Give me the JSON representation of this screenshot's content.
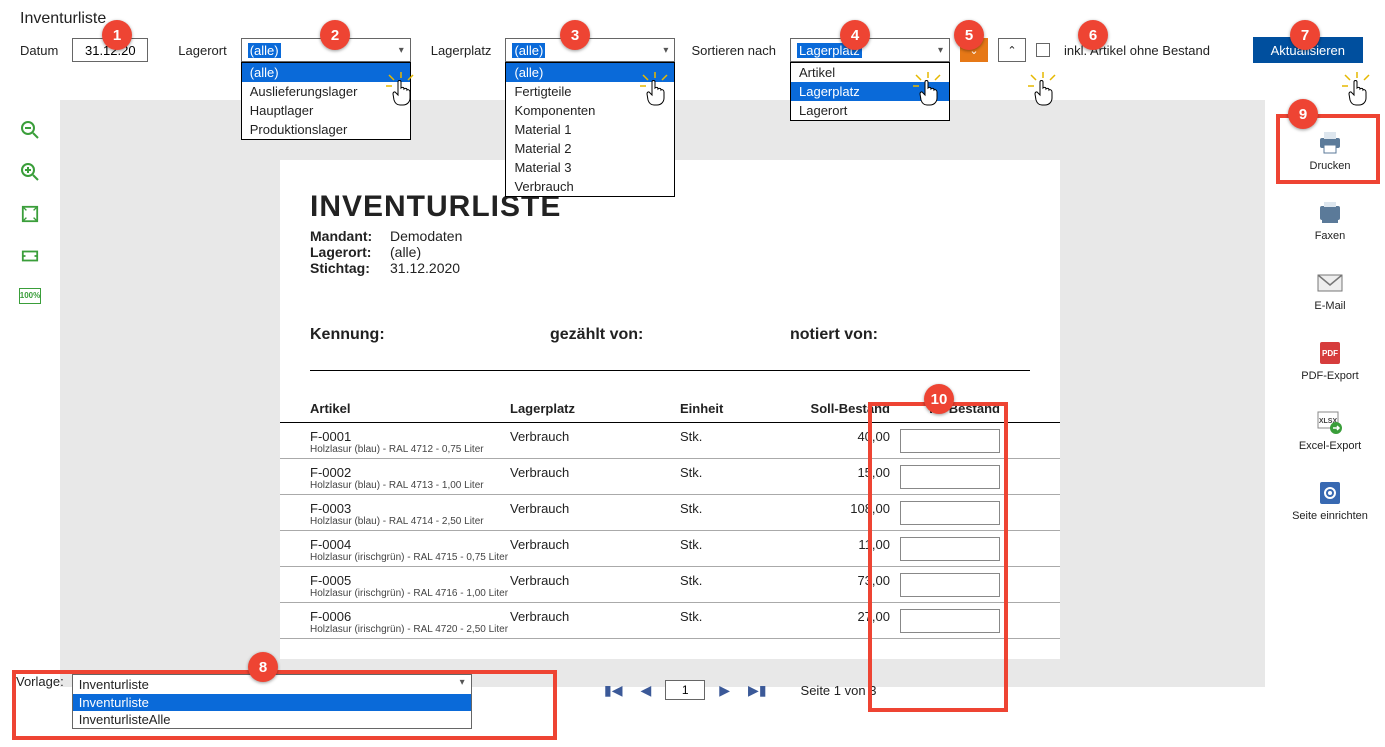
{
  "title": "Inventurliste",
  "filters": {
    "datum_label": "Datum",
    "datum_value": "31.12.20",
    "lagerort_label": "Lagerort",
    "lagerort_value": "(alle)",
    "lagerort_options": [
      "(alle)",
      "Auslieferungslager",
      "Hauptlager",
      "Produktionslager"
    ],
    "lagerplatz_label": "Lagerplatz",
    "lagerplatz_value": "(alle)",
    "lagerplatz_options": [
      "(alle)",
      "Fertigteile",
      "Komponenten",
      "Material 1",
      "Material 2",
      "Material 3",
      "Verbrauch"
    ],
    "sort_label": "Sortieren nach",
    "sort_value": "Lagerplatz",
    "sort_options": [
      "Artikel",
      "Lagerplatz",
      "Lagerort"
    ],
    "inkl_label": "inkl. Artikel ohne Bestand",
    "refresh_label": "Aktualisieren"
  },
  "actions": {
    "print": "Drucken",
    "fax": "Faxen",
    "email": "E-Mail",
    "pdf": "PDF-Export",
    "xlsx": "Excel-Export",
    "setup": "Seite einrichten"
  },
  "report": {
    "heading": "INVENTURLISTE",
    "mandant_label": "Mandant:",
    "mandant_value": "Demodaten",
    "lagerort_label": "Lagerort:",
    "lagerort_value": "(alle)",
    "stichtag_label": "Stichtag:",
    "stichtag_value": "31.12.2020",
    "kennung": "Kennung:",
    "gezaehlt": "gezählt von:",
    "notiert": "notiert von:",
    "col_artikel": "Artikel",
    "col_lagerplatz": "Lagerplatz",
    "col_einheit": "Einheit",
    "col_soll": "Soll-Bestand",
    "col_ist": "Ist-Bestand",
    "rows": [
      {
        "art": "F-0001",
        "desc": "Holzlasur (blau) - RAL 4712 - 0,75 Liter",
        "lp": "Verbrauch",
        "ein": "Stk.",
        "soll": "40,00"
      },
      {
        "art": "F-0002",
        "desc": "Holzlasur (blau) - RAL 4713 - 1,00 Liter",
        "lp": "Verbrauch",
        "ein": "Stk.",
        "soll": "15,00"
      },
      {
        "art": "F-0003",
        "desc": "Holzlasur (blau) - RAL 4714 - 2,50 Liter",
        "lp": "Verbrauch",
        "ein": "Stk.",
        "soll": "108,00"
      },
      {
        "art": "F-0004",
        "desc": "Holzlasur (irischgrün) - RAL 4715 - 0,75 Liter",
        "lp": "Verbrauch",
        "ein": "Stk.",
        "soll": "11,00"
      },
      {
        "art": "F-0005",
        "desc": "Holzlasur (irischgrün) - RAL 4716 - 1,00 Liter",
        "lp": "Verbrauch",
        "ein": "Stk.",
        "soll": "73,00"
      },
      {
        "art": "F-0006",
        "desc": "Holzlasur (irischgrün) - RAL 4720 - 2,50 Liter",
        "lp": "Verbrauch",
        "ein": "Stk.",
        "soll": "27,00"
      }
    ]
  },
  "pager": {
    "page": "1",
    "status": "Seite 1 von 3"
  },
  "vorlage": {
    "label": "Vorlage:",
    "value": "Inventurliste",
    "options": [
      "Inventurliste",
      "InventurlisteAlle"
    ]
  },
  "callouts": [
    "1",
    "2",
    "3",
    "4",
    "5",
    "6",
    "7",
    "8",
    "9",
    "10"
  ]
}
